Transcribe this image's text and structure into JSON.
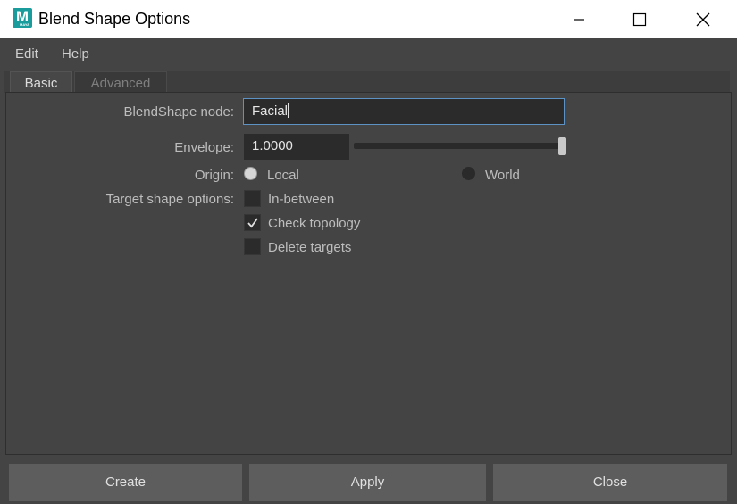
{
  "window": {
    "title": "Blend Shape Options",
    "app_icon_letter": "M",
    "app_icon_caption": "MAYA",
    "controls": [
      "minimize",
      "maximize",
      "close"
    ]
  },
  "menu": {
    "items": [
      "Edit",
      "Help"
    ]
  },
  "tabs": [
    {
      "label": "Basic",
      "active": true
    },
    {
      "label": "Advanced",
      "active": false
    }
  ],
  "form": {
    "blendshape_node": {
      "label": "BlendShape node:",
      "value": "Facial"
    },
    "envelope": {
      "label": "Envelope:",
      "value": "1.0000",
      "slider_fraction": 1.0
    },
    "origin": {
      "label": "Origin:",
      "options": [
        {
          "label": "Local",
          "selected": true
        },
        {
          "label": "World",
          "selected": false
        }
      ]
    },
    "target_shape_options": {
      "label": "Target shape options:",
      "options": [
        {
          "label": "In-between",
          "checked": false
        },
        {
          "label": "Check topology",
          "checked": true
        },
        {
          "label": "Delete targets",
          "checked": false
        }
      ]
    }
  },
  "buttons": {
    "create": "Create",
    "apply": "Apply",
    "close": "Close"
  }
}
